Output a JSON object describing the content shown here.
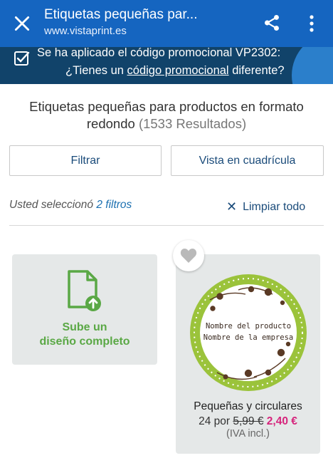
{
  "browser": {
    "title": "Etiquetas pequeñas par...",
    "url": "www.vistaprint.es",
    "icons": [
      "close-icon",
      "share-icon",
      "more-vert-icon"
    ],
    "color": "#1565c0"
  },
  "promo": {
    "line1": "Se ha aplicado el código promocional VP2302:",
    "line2_prefix": "¿Tienes un ",
    "line2_link": "código promocional",
    "line2_suffix": " diferente?",
    "icon": "check-square-icon",
    "color": "#11436a"
  },
  "heading": {
    "title": "Etiquetas pequeñas para productos en formato redondo",
    "count": "(1533 Resultados)"
  },
  "buttons": {
    "filter": "Filtrar",
    "grid": "Vista en cuadrícula"
  },
  "filters": {
    "selected_prefix": "Usted seleccionó ",
    "selected_count": "2 filtros",
    "clear_icon": "close-icon",
    "clear_label": "Limpiar todo"
  },
  "upload_card": {
    "label_line1": "Sube un",
    "label_line2": "diseño completo",
    "icon": "upload-file-icon"
  },
  "product": {
    "name": "Pequeñas y circulares",
    "qty": "24 por",
    "old_price": "5,99 €",
    "new_price": "2,40 €",
    "tax": "(IVA incl.)",
    "sticker_line1": "Nombre del producto",
    "sticker_line2": "Nombre de la empresa",
    "favorite_icon": "heart-icon",
    "accent_color": "#d6247c"
  }
}
